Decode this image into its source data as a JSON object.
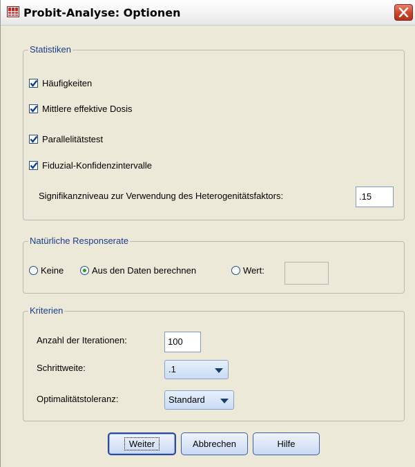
{
  "window": {
    "title": "Probit-Analyse: Optionen"
  },
  "statistics": {
    "group_label": "Statistiken",
    "items": [
      {
        "label": "Häufigkeiten",
        "checked": true
      },
      {
        "label": "Mittlere effektive Dosis",
        "checked": true
      },
      {
        "label": "Parallelitätstest",
        "checked": true
      },
      {
        "label": "Fiduzial-Konfidenzintervalle",
        "checked": true
      }
    ],
    "significance_label": "Signifikanzniveau zur Verwendung des Heterogenitätsfaktors:",
    "significance_value": ".15"
  },
  "response": {
    "group_label": "Natürliche Responserate",
    "options": [
      {
        "label": "Keine",
        "selected": false
      },
      {
        "label": "Aus den Daten berechnen",
        "selected": true
      },
      {
        "label": "Wert:",
        "selected": false
      }
    ],
    "value": ""
  },
  "criteria": {
    "group_label": "Kriterien",
    "iterations_label": "Anzahl der Iterationen:",
    "iterations_value": "100",
    "step_label": "Schrittweite:",
    "step_value": ".1",
    "tolerance_label": "Optimalitätstoleranz:",
    "tolerance_value": "Standard"
  },
  "buttons": {
    "continue": "Weiter",
    "cancel": "Abbrechen",
    "help": "Hilfe"
  },
  "colors": {
    "group_label": "#1a3c8c",
    "dialog_bg": "#ece9d8",
    "close_button": "#c9442a",
    "radio_dot": "#21a121"
  }
}
